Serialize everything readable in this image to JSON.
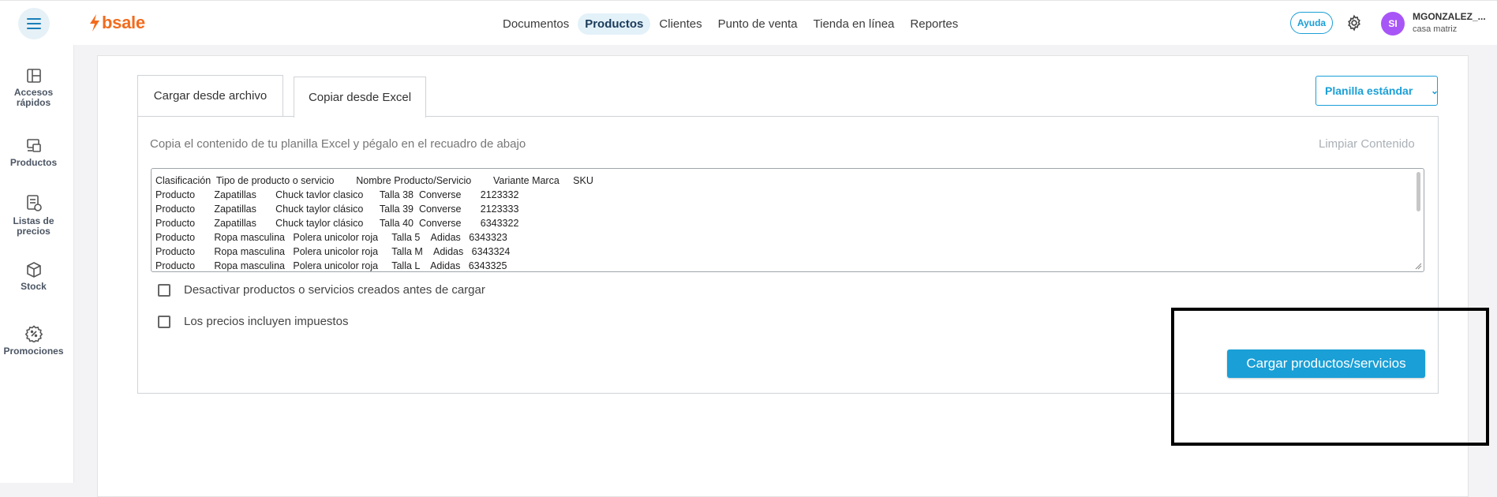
{
  "header": {
    "logo_text": "bsale",
    "nav": [
      {
        "label": "Documentos",
        "active": false
      },
      {
        "label": "Productos",
        "active": true
      },
      {
        "label": "Clientes",
        "active": false
      },
      {
        "label": "Punto de venta",
        "active": false
      },
      {
        "label": "Tienda en línea",
        "active": false
      },
      {
        "label": "Reportes",
        "active": false
      }
    ],
    "help_label": "Ayuda",
    "avatar_initials": "SI",
    "user_name": "MGONZALEZ_...",
    "user_branch": "casa matriz"
  },
  "sidebar": {
    "items": [
      {
        "label": "Accesos rápidos",
        "icon": "layout-icon"
      },
      {
        "label": "Productos",
        "icon": "products-icon"
      },
      {
        "label": "Listas de precios",
        "icon": "price-list-icon"
      },
      {
        "label": "Stock",
        "icon": "box-icon"
      },
      {
        "label": "Promociones",
        "icon": "discount-icon"
      }
    ]
  },
  "upload": {
    "tabs": [
      "Cargar desde archivo",
      "Copiar desde Excel"
    ],
    "active_tab": "Copiar desde Excel",
    "template_label": "Planilla estándar",
    "instructions": "Copia el contenido de tu planilla Excel y pégalo en el recuadro de abajo",
    "clear_label": "Limpiar Contenido",
    "paste_rows": [
      "Clasificación  Tipo de producto o servicio        Nombre Producto/Servicio        Variante Marca     SKU",
      "Producto       Zapatillas       Chuck tavlor clasico      Talla 38  Converse       2123332",
      "Producto       Zapatillas       Chuck taylor clásico      Talla 39  Converse       2123333",
      "Producto       Zapatillas       Chuck taylor clásico      Talla 40  Converse       6343322",
      "Producto       Ropa masculina   Polera unicolor roja     Talla 5    Adidas   6343323",
      "Producto       Ropa masculina   Polera unicolor roja     Talla M    Adidas   6343324",
      "Producto       Ropa masculina   Polera unicolor roja     Talla L    Adidas   6343325"
    ],
    "option_deactivate": "Desactivar productos o servicios creados antes de cargar",
    "option_taxes": "Los precios incluyen impuestos",
    "submit_label": "Cargar productos/servicios"
  },
  "colors": {
    "accent": "#1a9fd6",
    "brand": "#f26b1d",
    "avatar": "#a855f7"
  }
}
